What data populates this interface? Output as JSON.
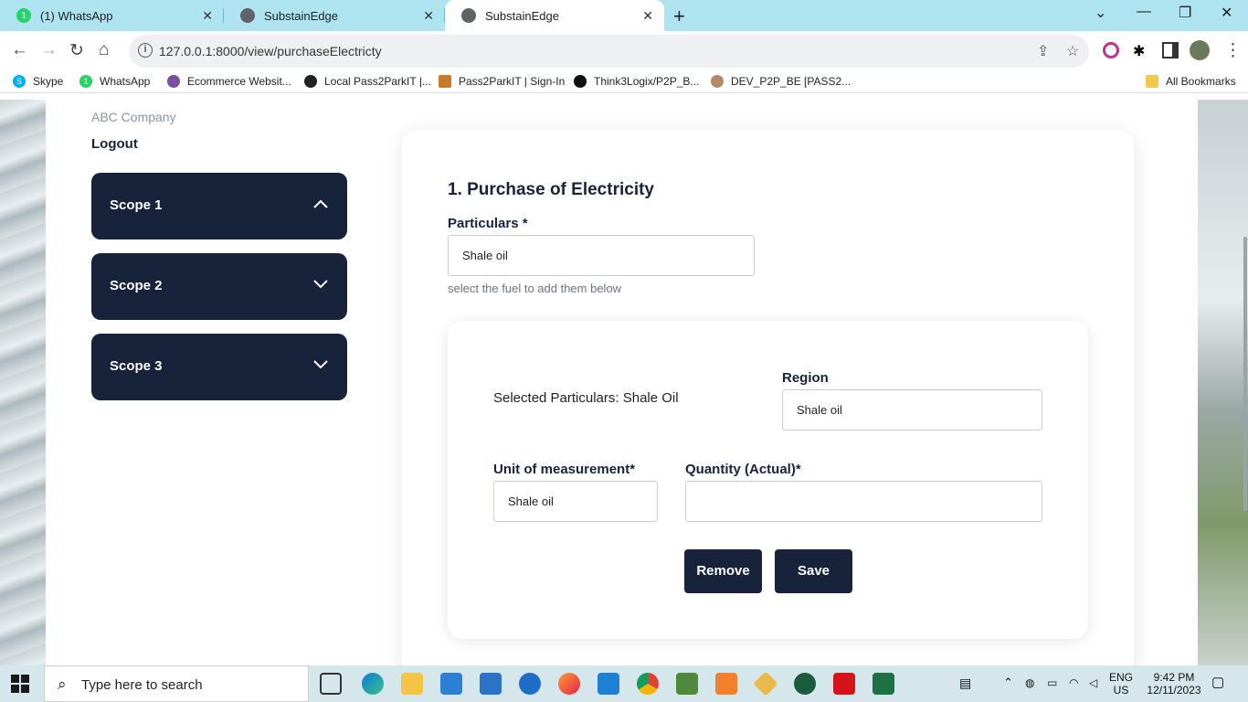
{
  "browser": {
    "tabs": [
      {
        "title": "(1) WhatsApp",
        "icon": "whatsapp-icon",
        "active": false
      },
      {
        "title": "SubstainEdge",
        "icon": "globe-icon",
        "active": false
      },
      {
        "title": "SubstainEdge",
        "icon": "globe-icon",
        "active": true
      }
    ],
    "url": "127.0.0.1:8000/view/purchaseElectricty",
    "bookmarks": [
      {
        "label": "Skype",
        "icon": "skype-icon"
      },
      {
        "label": "WhatsApp",
        "icon": "whatsapp-icon"
      },
      {
        "label": "Ecommerce Websit...",
        "icon": "link-icon"
      },
      {
        "label": "Local Pass2ParkIT |...",
        "icon": "globe-icon"
      },
      {
        "label": "Pass2ParkIT | Sign-In",
        "icon": "car-icon"
      },
      {
        "label": "Think3Logix/P2P_B...",
        "icon": "github-icon"
      },
      {
        "label": "DEV_P2P_BE [PASS2...",
        "icon": "avatar-icon"
      }
    ],
    "all_bookmarks": "All Bookmarks"
  },
  "sidebar": {
    "company": "ABC Company",
    "logout": "Logout",
    "scopes": [
      {
        "label": "Scope 1",
        "expanded": true
      },
      {
        "label": "Scope 2",
        "expanded": false
      },
      {
        "label": "Scope 3",
        "expanded": false
      }
    ]
  },
  "form": {
    "title": "1. Purchase of Electricity",
    "particulars_label": "Particulars *",
    "particulars_value": "Shale oil",
    "hint": "select the fuel to add them below",
    "entry": {
      "selected_text": "Selected Particulars: Shale Oil",
      "region_label": "Region",
      "region_value": "Shale oil",
      "unit_label": "Unit of measurement*",
      "unit_value": "Shale oil",
      "quantity_label": "Quantity (Actual)*",
      "quantity_value": "",
      "remove_label": "Remove",
      "save_label": "Save"
    }
  },
  "taskbar": {
    "search_placeholder": "Type here to search",
    "lang": "ENG",
    "region": "US",
    "time": "9:42 PM",
    "date": "12/11/2023"
  },
  "colors": {
    "primary": "#17233a",
    "tabbar": "#aee3f0",
    "taskbar": "#d5e7ea"
  }
}
